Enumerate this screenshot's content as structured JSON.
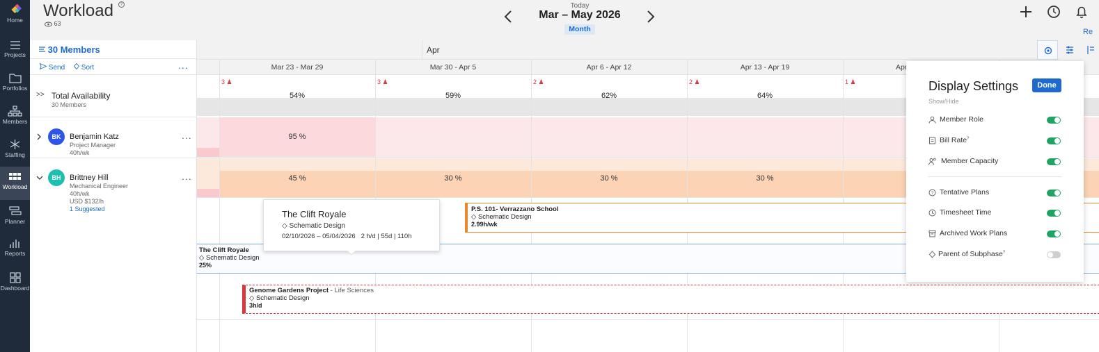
{
  "nav": {
    "items": [
      {
        "label": "Home"
      },
      {
        "label": "Projects"
      },
      {
        "label": "Portfolios"
      },
      {
        "label": "Members"
      },
      {
        "label": "Staffing"
      },
      {
        "label": "Workload"
      },
      {
        "label": "Planner"
      },
      {
        "label": "Reports"
      },
      {
        "label": "Dashboard"
      }
    ],
    "active": "Workload"
  },
  "header": {
    "title": "Workload",
    "viewer_count": "63",
    "today_label": "Today",
    "date_range": "Mar – May 2026",
    "view_mode": "Month",
    "right_link": "Re"
  },
  "members_panel": {
    "count_label": "30 Members",
    "send_label": "Send",
    "sort_label": "Sort",
    "more_label": "...",
    "total": {
      "title": "Total Availability",
      "subtitle": "30 Members"
    },
    "members": [
      {
        "initials": "BK",
        "name": "Benjamin Katz",
        "role": "Project Manager",
        "capacity": "40h/wk",
        "color": "#2f55e6"
      },
      {
        "initials": "BH",
        "name": "Brittney Hill",
        "role": "Mechanical Engineer",
        "capacity": "40h/wk",
        "rate": "USD $132/h",
        "suggested": "1 Suggested",
        "color": "#1fbfb0"
      }
    ]
  },
  "timeline": {
    "month_label": "Apr",
    "weeks": [
      "Mar 23 - Mar 29",
      "Mar 30 - Apr 5",
      "Apr 6 - Apr 12",
      "Apr 13 - Apr 19",
      "Apr"
    ],
    "alerts": [
      "3",
      "3",
      "2",
      "2",
      "1"
    ],
    "total_pcts": [
      "54%",
      "59%",
      "62%",
      "64%"
    ],
    "benjamin_pcts": [
      "95 %"
    ],
    "brittney_pcts": [
      "45 %",
      "30 %",
      "30 %",
      "30 %"
    ],
    "bars": {
      "verrazzano": {
        "title": "P.S. 101- Verrazzano School",
        "phase": "Schematic Design",
        "hours": "2.99h/wk"
      },
      "clift": {
        "title": "The Clift Royale",
        "phase": "Schematic Design",
        "hours": "25%"
      },
      "genome": {
        "title": "Genome Gardens Project",
        "client": "- Life Sciences",
        "phase": "Schematic Design",
        "hours": "3h/d"
      }
    }
  },
  "tooltip": {
    "title": "The Clift Royale",
    "phase": "Schematic Design",
    "dates": "02/10/2026 – 05/04/2026",
    "stats": "2 h/d | 55d | 110h"
  },
  "display_settings": {
    "title": "Display Settings",
    "done_label": "Done",
    "section_label": "Show/Hide",
    "items": [
      {
        "label": "Member Role",
        "on": true
      },
      {
        "label": "Bill Rate",
        "on": true
      },
      {
        "label": "Member Capacity",
        "on": true
      },
      {
        "label": "Tentative Plans",
        "on": true
      },
      {
        "label": "Timesheet Time",
        "on": true
      },
      {
        "label": "Archived Work Plans",
        "on": true
      },
      {
        "label": "Parent of Subphase",
        "on": false
      }
    ]
  },
  "colors": {
    "nav_bg": "#1f2a3a",
    "accent": "#1e6ad0",
    "toggle_on": "#21a366",
    "over_capacity": "#fde4e6",
    "partial": "#fcd3b5",
    "alert": "#d9363e"
  }
}
